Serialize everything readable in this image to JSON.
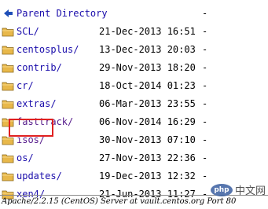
{
  "listing": {
    "rows": [
      {
        "name": "Parent Directory",
        "date": "",
        "size": "-",
        "icon": "back-arrow-icon"
      },
      {
        "name": "SCL/",
        "date": "21-Dec-2013 16:51",
        "size": "-",
        "icon": "folder-icon"
      },
      {
        "name": "centosplus/",
        "date": "13-Dec-2013 20:03",
        "size": "-",
        "icon": "folder-icon"
      },
      {
        "name": "contrib/",
        "date": "29-Nov-2013 18:20",
        "size": "-",
        "icon": "folder-icon"
      },
      {
        "name": "cr/",
        "date": "18-Oct-2014 01:23",
        "size": "-",
        "icon": "folder-icon"
      },
      {
        "name": "extras/",
        "date": "06-Mar-2013 23:55",
        "size": "-",
        "icon": "folder-icon"
      },
      {
        "name": "fasttrack/",
        "date": "06-Nov-2014 16:29",
        "size": "-",
        "icon": "folder-icon"
      },
      {
        "name": "isos/",
        "date": "30-Nov-2013 07:10",
        "size": "-",
        "icon": "folder-icon"
      },
      {
        "name": "os/",
        "date": "27-Nov-2013 22:36",
        "size": "-",
        "icon": "folder-icon"
      },
      {
        "name": "updates/",
        "date": "19-Dec-2013 12:32",
        "size": "-",
        "icon": "folder-icon"
      },
      {
        "name": "xen4/",
        "date": "21-Jun-2013 11:27",
        "size": "-",
        "icon": "folder-icon"
      }
    ]
  },
  "footer": {
    "text": "Apache/2.2.15 (CentOS) Server at vault.centos.org Port 80"
  },
  "watermark": {
    "logo": "php",
    "text": "中文网"
  },
  "colors": {
    "link": "#1a0dab",
    "visited_link": "#551a8b",
    "highlight_box": "#e02020",
    "folder": "#e8b84a"
  }
}
